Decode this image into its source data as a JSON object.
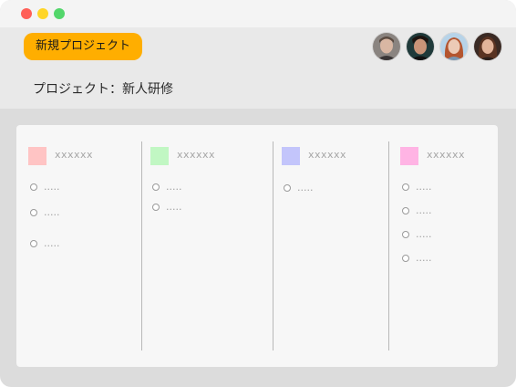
{
  "window": {
    "controls": [
      {
        "name": "close",
        "color": "#ff5f57"
      },
      {
        "name": "minimize",
        "color": "#ffd527"
      },
      {
        "name": "maximize",
        "color": "#53d66b"
      }
    ]
  },
  "header": {
    "new_project_label": "新規プロジェクト",
    "new_project_color": "#ffae00",
    "project_title": "プロジェクト：新人研修",
    "avatars": [
      {
        "icon": "person-avatar-icon"
      },
      {
        "icon": "person-avatar-icon"
      },
      {
        "icon": "person-avatar-icon"
      },
      {
        "icon": "person-avatar-icon"
      }
    ]
  },
  "board": {
    "columns": [
      {
        "title": "xxxxxx",
        "color": "#ffc4c4",
        "items": [
          ".....",
          ".....",
          "....."
        ]
      },
      {
        "title": "xxxxxx",
        "color": "#c1f7c3",
        "items": [
          ".....",
          "....."
        ]
      },
      {
        "title": "xxxxxx",
        "color": "#c3c5fb",
        "items": [
          "....."
        ]
      },
      {
        "title": "xxxxxx",
        "color": "#ffb4e4",
        "items": [
          ".....",
          ".....",
          ".....",
          "....."
        ]
      }
    ]
  }
}
